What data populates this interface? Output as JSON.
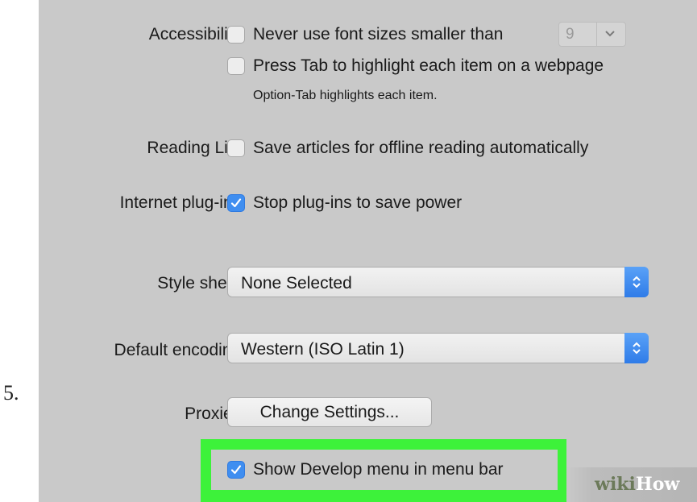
{
  "step_number": "5.",
  "accessibility": {
    "label": "Accessibility:",
    "never_font_label": "Never use font sizes smaller than",
    "never_font_checked": false,
    "font_size_value": "9",
    "press_tab_label": "Press Tab to highlight each item on a webpage",
    "press_tab_checked": false,
    "hint": "Option-Tab highlights each item."
  },
  "reading_list": {
    "label": "Reading List:",
    "option_label": "Save articles for offline reading automatically",
    "checked": false
  },
  "plugins": {
    "label": "Internet plug-ins:",
    "option_label": "Stop plug-ins to save power",
    "checked": true
  },
  "style_sheet": {
    "label": "Style sheet:",
    "value": "None Selected"
  },
  "encoding": {
    "label": "Default encoding:",
    "value": "Western (ISO Latin 1)"
  },
  "proxies": {
    "label": "Proxies:",
    "button_label": "Change Settings..."
  },
  "develop": {
    "option_label": "Show Develop menu in menu bar",
    "checked": true
  },
  "watermark": {
    "part1": "wiki",
    "part2": "How"
  },
  "colors": {
    "panel": "#c9c9c9",
    "checkbox_checked": "#3f8ef0",
    "highlight": "#3df23a"
  }
}
